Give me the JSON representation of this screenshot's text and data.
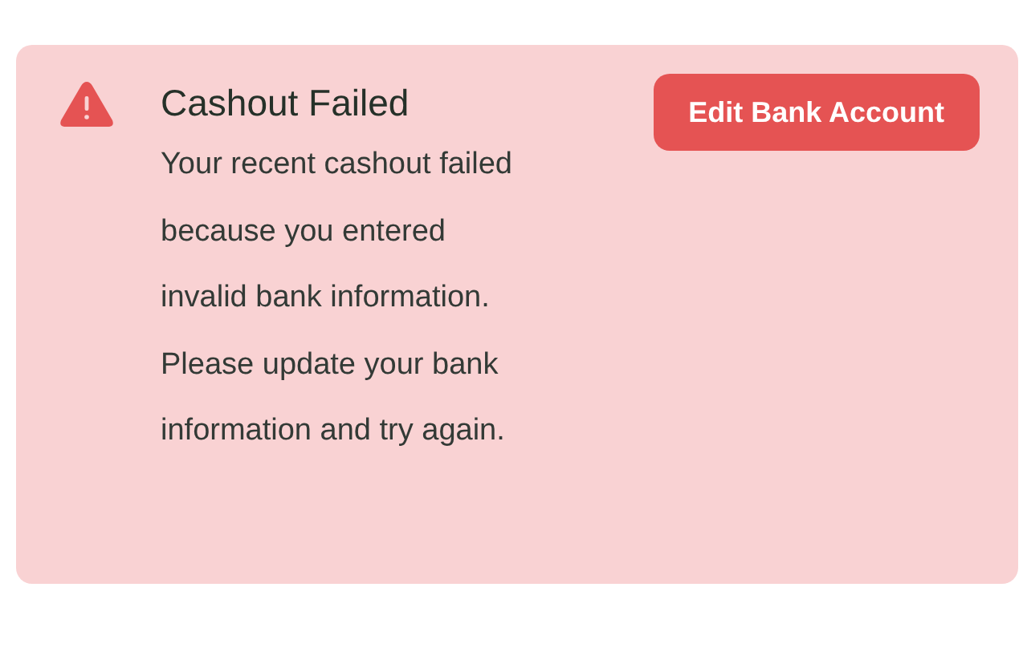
{
  "alert": {
    "title": "Cashout Failed",
    "message": "Your recent cashout failed because you entered invalid bank information. Please update your bank information and try again.",
    "action": "Edit Bank Account"
  }
}
